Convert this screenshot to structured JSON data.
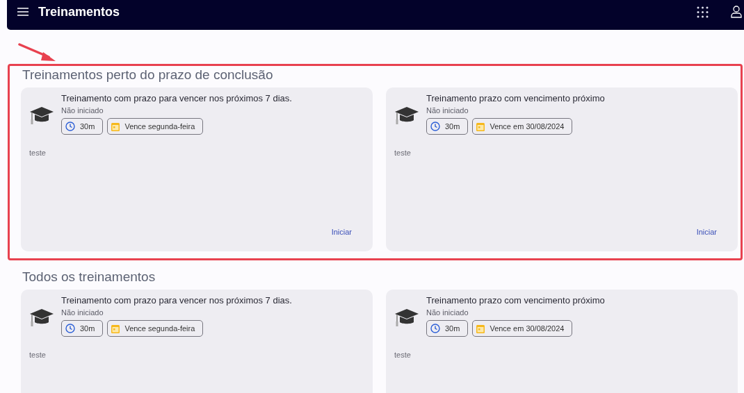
{
  "header": {
    "title": "Treinamentos"
  },
  "sections": [
    {
      "title": "Treinamentos perto do prazo de conclusão",
      "highlighted": true,
      "cards": [
        {
          "title": "Treinamento com prazo para vencer nos próximos 7 dias.",
          "status": "Não iniciado",
          "duration": "30m",
          "due": "Vence segunda-feira",
          "description": "teste",
          "action": "Iniciar"
        },
        {
          "title": "Treinamento prazo com vencimento próximo",
          "status": "Não iniciado",
          "duration": "30m",
          "due": "Vence em 30/08/2024",
          "description": "teste",
          "action": "Iniciar"
        }
      ]
    },
    {
      "title": "Todos os treinamentos",
      "highlighted": false,
      "cards": [
        {
          "title": "Treinamento com prazo para vencer nos próximos 7 dias.",
          "status": "Não iniciado",
          "duration": "30m",
          "due": "Vence segunda-feira",
          "description": "teste"
        },
        {
          "title": "Treinamento prazo com vencimento próximo",
          "status": "Não iniciado",
          "duration": "30m",
          "due": "Vence em 30/08/2024",
          "description": "teste"
        }
      ]
    }
  ]
}
